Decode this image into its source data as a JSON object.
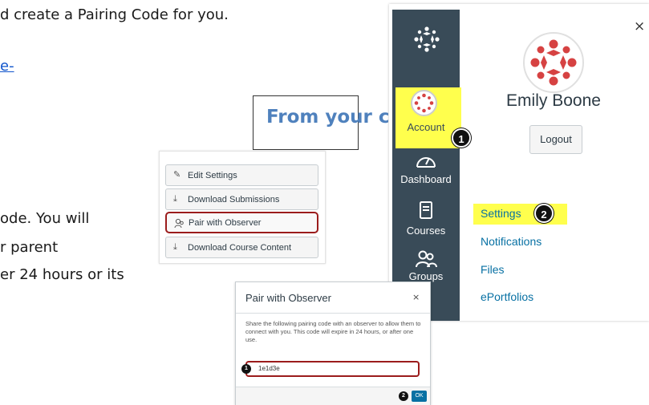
{
  "document": {
    "line1": "d create a Pairing Code for you.",
    "link_fragment": "e-",
    "line2": "ode. You will",
    "line3": "r parent",
    "line4": "er 24 hours or its"
  },
  "callout": {
    "text": "From your child’s account"
  },
  "course_buttons": [
    {
      "label": "Edit Settings",
      "icon": "pencil-icon"
    },
    {
      "label": "Download Submissions",
      "icon": "download-icon"
    },
    {
      "label": "Pair with Observer",
      "icon": "users-icon"
    },
    {
      "label": "Download Course Content",
      "icon": "download-icon"
    }
  ],
  "nav": {
    "items": [
      {
        "label": "Account",
        "icon": "account-avatar"
      },
      {
        "label": "Dashboard",
        "icon": "dashboard-icon"
      },
      {
        "label": "Courses",
        "icon": "book-icon"
      },
      {
        "label": "Groups",
        "icon": "groups-icon"
      }
    ]
  },
  "profile": {
    "name": "Emily Boone",
    "logout_label": "Logout",
    "close_symbol": "×",
    "links": [
      {
        "label": "Settings"
      },
      {
        "label": "Notifications"
      },
      {
        "label": "Files"
      },
      {
        "label": "ePortfolios"
      }
    ]
  },
  "steps": {
    "one": "1",
    "two": "2"
  },
  "modal": {
    "title": "Pair with Observer",
    "close_symbol": "×",
    "body": "Share the following pairing code with an observer to allow them to connect with you. This code will expire in 24 hours, or after one use.",
    "code": "1e1d3e",
    "ok_label": "OK"
  },
  "colors": {
    "accent": "#4f81bd",
    "canvas_nav": "#394b58",
    "highlight": "#ffff4d",
    "link": "#0770a3",
    "red_outline": "#9b1c1c"
  }
}
